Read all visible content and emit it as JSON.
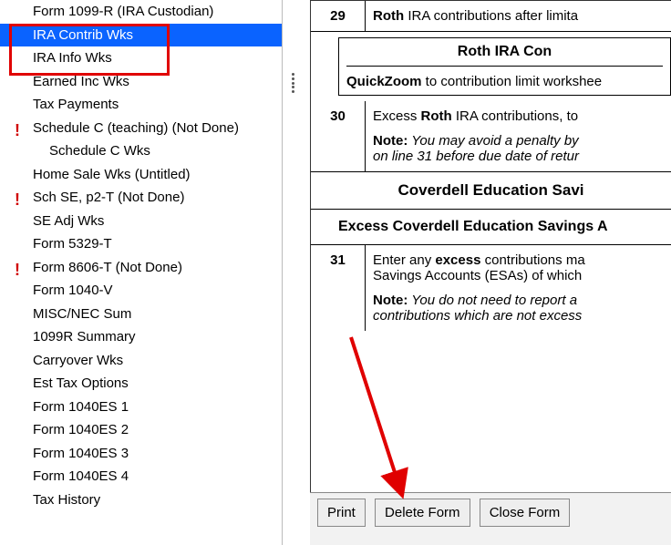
{
  "sidebar": {
    "items": [
      {
        "label": "Form 1099-R (IRA Custodian)",
        "indent": 0,
        "flag": false,
        "selected": false
      },
      {
        "label": "IRA Contrib Wks",
        "indent": 0,
        "flag": false,
        "selected": true
      },
      {
        "label": "IRA Info Wks",
        "indent": 0,
        "flag": false,
        "selected": false
      },
      {
        "label": "Earned Inc Wks",
        "indent": 0,
        "flag": false,
        "selected": false
      },
      {
        "label": "Tax Payments",
        "indent": 0,
        "flag": false,
        "selected": false
      },
      {
        "label": "Schedule C (teaching) (Not Done)",
        "indent": 0,
        "flag": true,
        "selected": false
      },
      {
        "label": "Schedule C Wks",
        "indent": 1,
        "flag": false,
        "selected": false
      },
      {
        "label": "Home Sale Wks (Untitled)",
        "indent": 0,
        "flag": false,
        "selected": false
      },
      {
        "label": "Sch SE, p2-T (Not Done)",
        "indent": 0,
        "flag": true,
        "selected": false
      },
      {
        "label": "SE Adj Wks",
        "indent": 0,
        "flag": false,
        "selected": false
      },
      {
        "label": "Form 5329-T",
        "indent": 0,
        "flag": false,
        "selected": false
      },
      {
        "label": "Form 8606-T (Not Done)",
        "indent": 0,
        "flag": true,
        "selected": false
      },
      {
        "label": "Form 1040-V",
        "indent": 0,
        "flag": false,
        "selected": false
      },
      {
        "label": "MISC/NEC Sum",
        "indent": 0,
        "flag": false,
        "selected": false
      },
      {
        "label": "1099R Summary",
        "indent": 0,
        "flag": false,
        "selected": false
      },
      {
        "label": "Carryover Wks",
        "indent": 0,
        "flag": false,
        "selected": false
      },
      {
        "label": "Est Tax Options",
        "indent": 0,
        "flag": false,
        "selected": false
      },
      {
        "label": "Form 1040ES 1",
        "indent": 0,
        "flag": false,
        "selected": false
      },
      {
        "label": "Form 1040ES 2",
        "indent": 0,
        "flag": false,
        "selected": false
      },
      {
        "label": "Form 1040ES 3",
        "indent": 0,
        "flag": false,
        "selected": false
      },
      {
        "label": "Form 1040ES 4",
        "indent": 0,
        "flag": false,
        "selected": false
      },
      {
        "label": "Tax History",
        "indent": 0,
        "flag": false,
        "selected": false
      }
    ]
  },
  "form": {
    "line29": {
      "num": "29",
      "b1": "Roth",
      "rest": " IRA contributions after limita"
    },
    "boxTitle": "Roth IRA Con",
    "quickzoom": {
      "b": "QuickZoom",
      "rest": " to contribution limit workshee"
    },
    "line30": {
      "num": "30",
      "p1a": "Excess ",
      "p1b": "Roth",
      "p1c": " IRA contributions, to ",
      "noteb": "Note:",
      "note1": " You may avoid a penalty by",
      "note2": "on line 31 before due date of retur"
    },
    "sectTitle": "Coverdell Education Savi",
    "sectSub": "Excess Coverdell Education Savings A",
    "line31": {
      "num": "31",
      "p1a": "Enter any ",
      "p1b": "excess",
      "p1c": " contributions ma",
      "p2": "Savings Accounts (ESAs) of which",
      "noteb": "Note:",
      "note1": " You do not need to report a",
      "note2": "contributions which are not excess"
    }
  },
  "buttons": {
    "print": "Print",
    "delete": "Delete Form",
    "close": "Close Form"
  }
}
